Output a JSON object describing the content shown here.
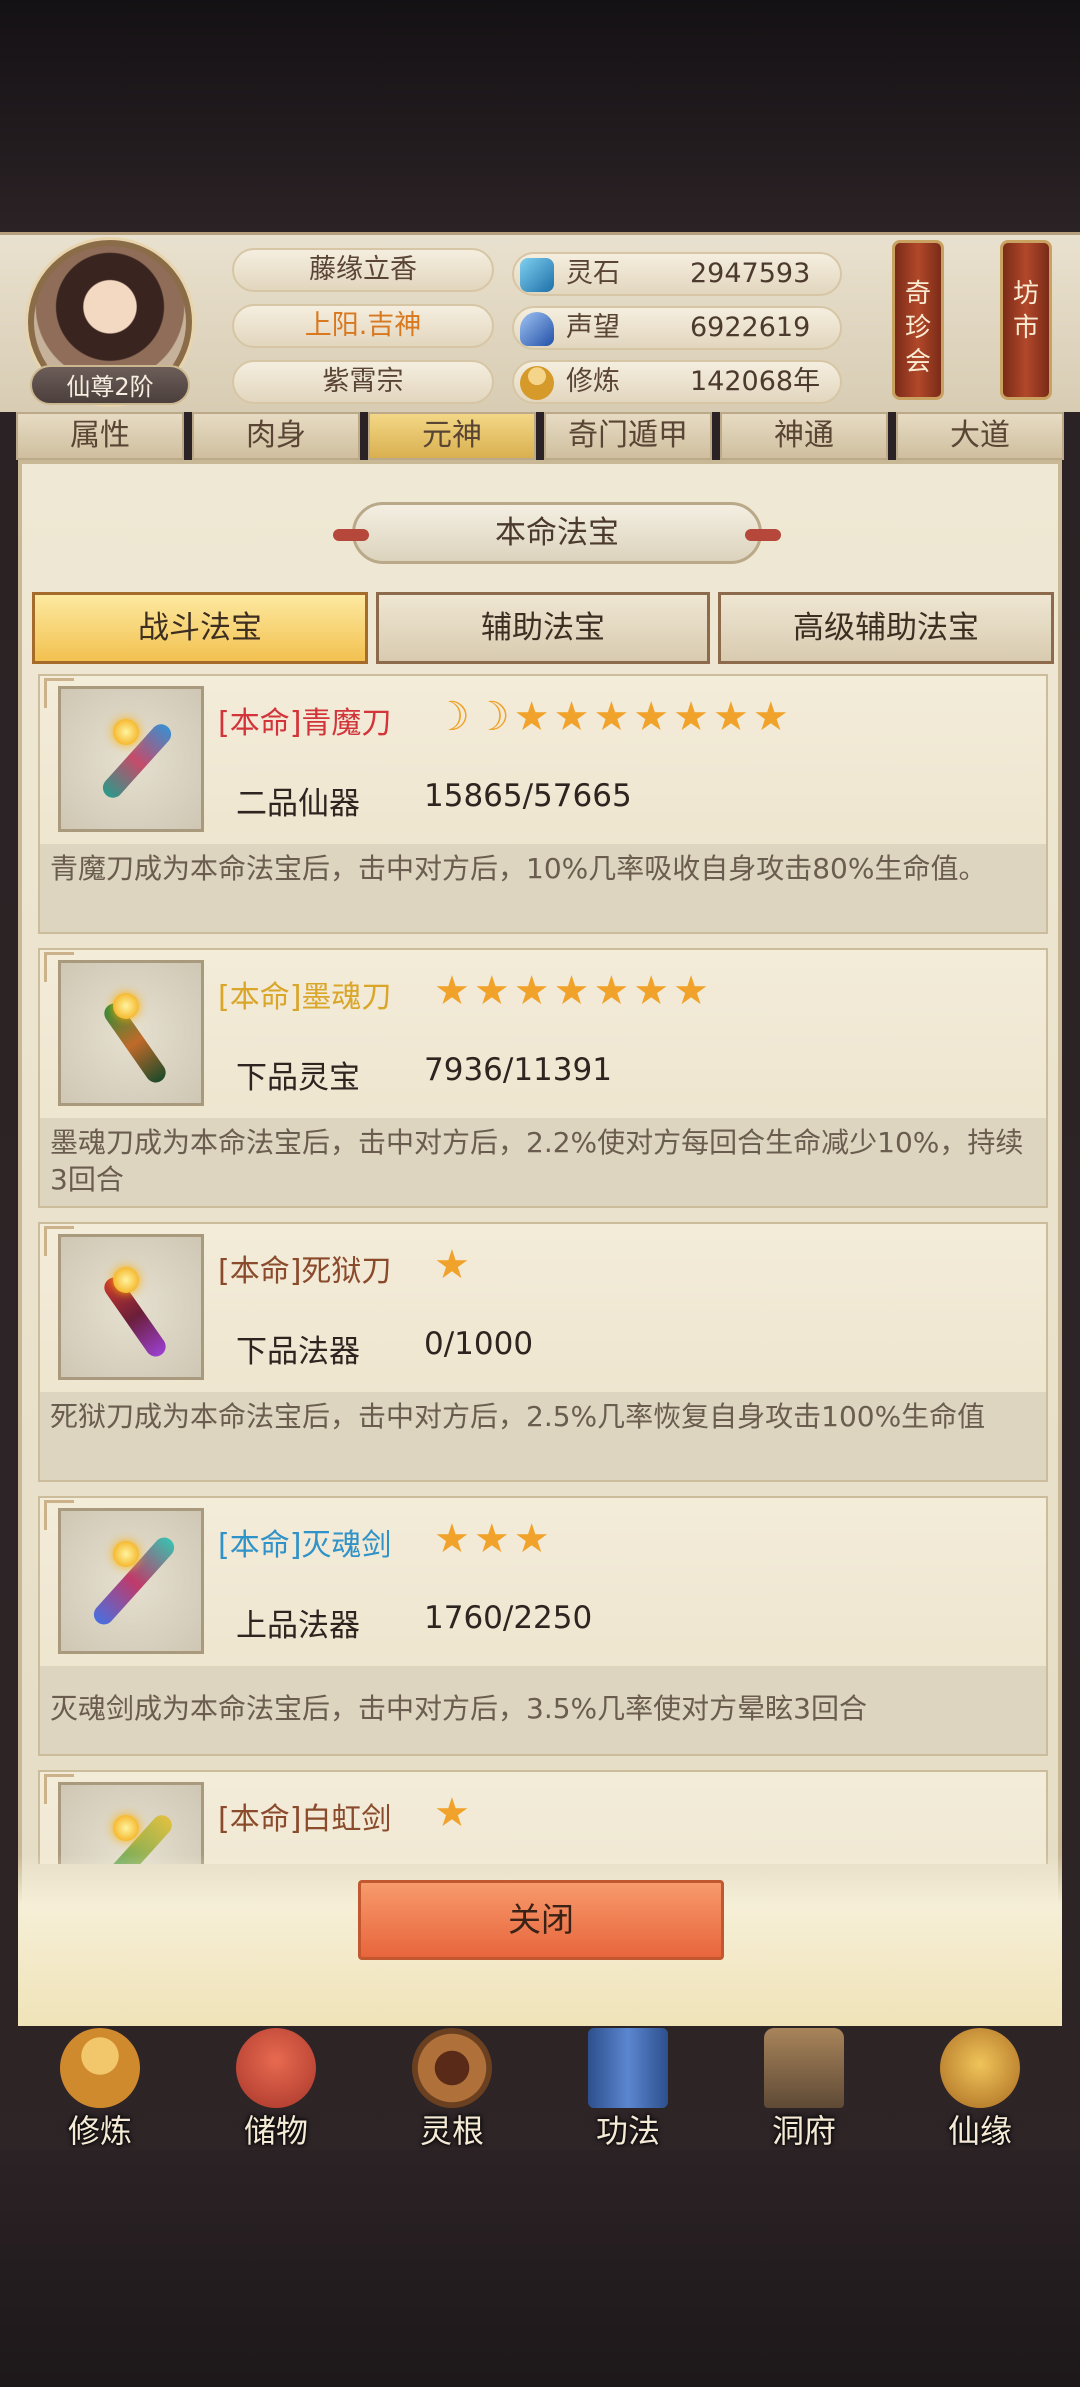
{
  "player": {
    "name": "藤缘立香",
    "title": "上阳.吉神",
    "sect": "紫霄宗",
    "rank": "仙尊2阶"
  },
  "resources": [
    {
      "label": "灵石",
      "value": "2947593",
      "icon": "spirit-stone-icon",
      "color": "#3a9fd0"
    },
    {
      "label": "声望",
      "value": "6922619",
      "icon": "prestige-icon",
      "color": "#3270c8"
    },
    {
      "label": "修炼",
      "value": "142068年",
      "icon": "meditation-icon",
      "color": "#d59a2a"
    }
  ],
  "side_buttons": [
    {
      "label": "奇珍会"
    },
    {
      "label": "坊市"
    }
  ],
  "tabs": [
    {
      "label": "属性"
    },
    {
      "label": "肉身"
    },
    {
      "label": "元神"
    },
    {
      "label": "奇门遁甲"
    },
    {
      "label": "神通"
    },
    {
      "label": "大道"
    }
  ],
  "panel": {
    "title": "本命法宝",
    "subtabs": [
      {
        "label": "战斗法宝",
        "active": true
      },
      {
        "label": "辅助法宝",
        "active": false
      },
      {
        "label": "高级辅助法宝",
        "active": false
      }
    ],
    "items": [
      {
        "name": "[本命]青魔刀",
        "name_color": "#d2343a",
        "stars": "☽☽★★★★★★★",
        "grade": "二品仙器",
        "exp": "15865/57665",
        "desc": "青魔刀成为本命法宝后，击中对方后，10%几率吸收自身攻击80%生命值。"
      },
      {
        "name": "[本命]墨魂刀",
        "name_color": "#d9a62a",
        "stars": "★★★★★★★",
        "grade": "下品灵宝",
        "exp": "7936/11391",
        "desc": "墨魂刀成为本命法宝后，击中对方后，2.2%使对方每回合生命减少10%，持续3回合"
      },
      {
        "name": "[本命]死狱刀",
        "name_color": "#8a4a2c",
        "stars": "★",
        "grade": "下品法器",
        "exp": "0/1000",
        "desc": "死狱刀成为本命法宝后，击中对方后，2.5%几率恢复自身攻击100%生命值"
      },
      {
        "name": "[本命]灭魂剑",
        "name_color": "#2f92c8",
        "stars": "★★★",
        "grade": "上品法器",
        "exp": "1760/2250",
        "desc": "灭魂剑成为本命法宝后，击中对方后，3.5%几率使对方晕眩3回合"
      },
      {
        "name": "[本命]白虹剑",
        "name_color": "#8a4a2c",
        "stars": "★",
        "grade": "",
        "exp": "",
        "desc": ""
      }
    ],
    "close_label": "关闭"
  },
  "bottom_nav": [
    {
      "label": "修炼",
      "icon": "monk-icon",
      "color": "#d08a2e"
    },
    {
      "label": "储物",
      "icon": "bag-icon",
      "color": "#c0483a"
    },
    {
      "label": "灵根",
      "icon": "taiji-icon",
      "color": "#9a6232"
    },
    {
      "label": "功法",
      "icon": "book-icon",
      "color": "#3e6fb4"
    },
    {
      "label": "洞府",
      "icon": "cave-house-icon",
      "color": "#8a6a4a"
    },
    {
      "label": "仙缘",
      "icon": "gourd-icon",
      "color": "#b8862e"
    }
  ]
}
